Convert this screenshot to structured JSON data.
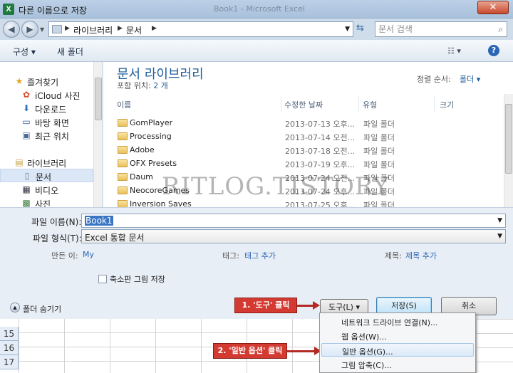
{
  "window": {
    "title": "다른 이름으로 저장",
    "background_title": "Book1 - Microsoft Excel",
    "app_icon": "X",
    "close_label": "✕"
  },
  "address": {
    "breadcrumbs": [
      "라이브러리",
      "문서"
    ],
    "search_placeholder": "문서 검색"
  },
  "toolbar": {
    "organize": "구성 ▾",
    "new_folder": "새 폴더"
  },
  "nav": {
    "items": [
      {
        "label": "즐겨찾기",
        "icon": "star-icon"
      },
      {
        "label": "iCloud 사진",
        "icon": "icloud-photos-icon"
      },
      {
        "label": "다운로드",
        "icon": "downloads-icon"
      },
      {
        "label": "바탕 화면",
        "icon": "desktop-icon"
      },
      {
        "label": "최근 위치",
        "icon": "recent-places-icon"
      },
      {
        "label": "라이브러리",
        "icon": "library-icon"
      },
      {
        "label": "문서",
        "icon": "documents-icon"
      },
      {
        "label": "비디오",
        "icon": "video-icon"
      },
      {
        "label": "사진",
        "icon": "pictures-icon"
      }
    ]
  },
  "library": {
    "title": "문서 라이브러리",
    "includes_label": "포함 위치:",
    "includes_value": "2 개",
    "sort_label": "정렬 순서:",
    "sort_value": "폴더 ▾"
  },
  "columns": [
    "이름",
    "수정한 날짜",
    "유형",
    "크기"
  ],
  "files": [
    {
      "name": "GomPlayer",
      "date": "2013-07-13 오후...",
      "type": "파일 폴더"
    },
    {
      "name": "Processing",
      "date": "2013-07-14 오전...",
      "type": "파일 폴더"
    },
    {
      "name": "Adobe",
      "date": "2013-07-18 오전...",
      "type": "파일 폴더"
    },
    {
      "name": "OFX Presets",
      "date": "2013-07-19 오후...",
      "type": "파일 폴더"
    },
    {
      "name": "Daum",
      "date": "2013-07-24 오전...",
      "type": "파일 폴더"
    },
    {
      "name": "NeocoreGames",
      "date": "2013-07-24 오후...",
      "type": "파일 폴더"
    },
    {
      "name": "Inversion Saves",
      "date": "2013-07-25 오후...",
      "type": "파일 폴더"
    }
  ],
  "watermark": "RITLOG.TISTORY",
  "form": {
    "filename_label": "파일 이름(N):",
    "filename_value": "Book1",
    "filetype_label": "파일 형식(T):",
    "filetype_value": "Excel 통합 문서",
    "author_label": "만든 이:",
    "author_value": "My",
    "tags_label": "태그:",
    "tags_value": "태그 추가",
    "title_label": "제목:",
    "title_value": "제목 추가",
    "thumbnail_label": "축소판 그림 저장",
    "hide_folders": "폴더 숨기기",
    "tools": "도구(L)  ▾",
    "save": "저장(S)",
    "cancel": "취소"
  },
  "callouts": {
    "step1": "1. '도구' 클릭",
    "step2": "2. '일반 옵션' 클릭",
    "color": "#d33b32"
  },
  "menu": {
    "items": [
      "네트워크 드라이브 연결(N)...",
      "웹 옵션(W)...",
      "일반 옵션(G)...",
      "그림 압축(C)..."
    ]
  },
  "excel": {
    "rows": [
      "15",
      "16",
      "17"
    ]
  }
}
